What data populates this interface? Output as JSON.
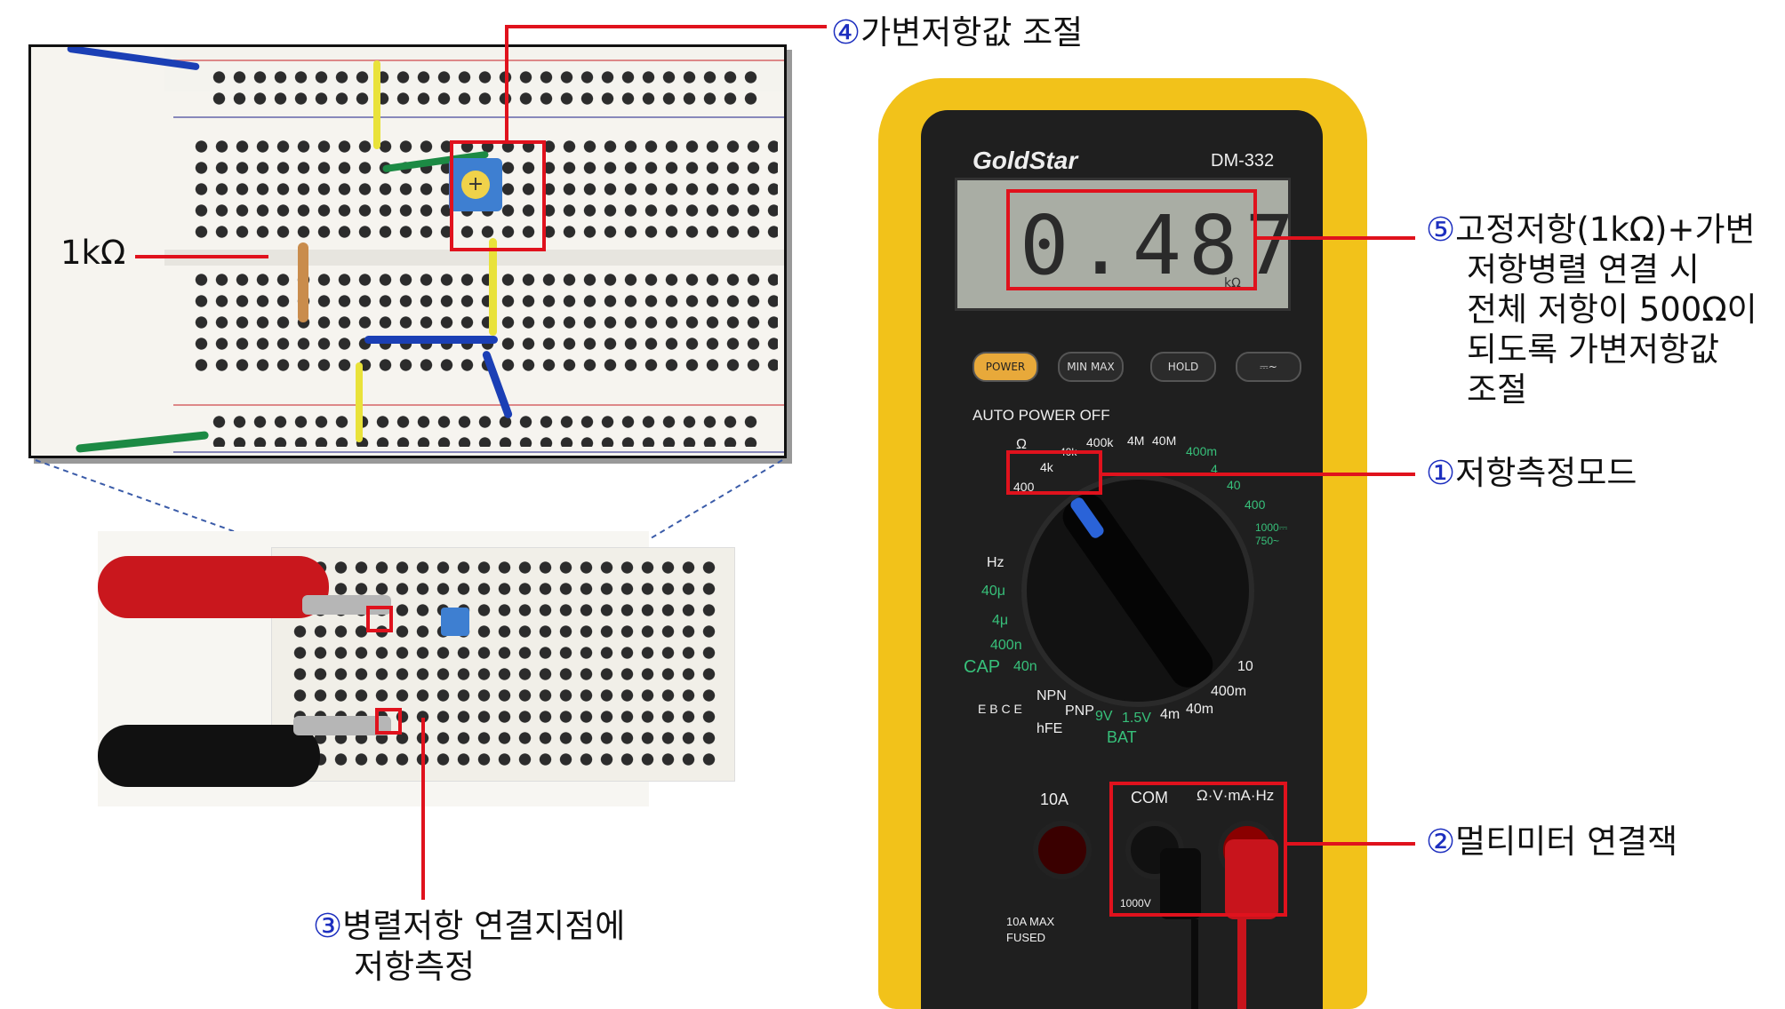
{
  "colors": {
    "callout_red": "#e0121d",
    "number_blue": "#1d2fbf",
    "meter_yellow": "#f2c21a",
    "meter_face": "#1f1f1f",
    "lcd": "#a9ada4"
  },
  "callouts": {
    "c1": {
      "num": "①",
      "text": "저항측정모드"
    },
    "c2": {
      "num": "②",
      "text": "멀티미터 연결잭"
    },
    "c3": {
      "num": "③",
      "line1": "병렬저항 연결지점에",
      "line2": "저항측정"
    },
    "c4": {
      "num": "④",
      "text": "가변저항값 조절"
    },
    "c5": {
      "num": "⑤",
      "line1": "고정저항(1kΩ)+가변",
      "line2": "저항병렬 연결 시",
      "line3": "전체 저항이 500Ω이",
      "line4": "되도록 가변저항값",
      "line5": "조절"
    }
  },
  "zoom": {
    "resistor_label": "1kΩ"
  },
  "meter": {
    "brand": "GoldStar",
    "model": "DM-332",
    "reading": "0.487",
    "unit": "kΩ",
    "buttons": [
      "POWER",
      "MIN MAX",
      "HOLD",
      "⎓~"
    ],
    "auto_power": "AUTO POWER OFF",
    "dial_labels": {
      "ohm": "Ω",
      "r400": "400",
      "r4k": "4k",
      "r40k": "40k",
      "r400k": "400k",
      "r4M": "4M",
      "r40M": "40M",
      "hz": "Hz",
      "c40u": "40μ",
      "c4u": "4μ",
      "c400n": "400n",
      "c40n": "40n",
      "cap": "CAP",
      "npn": "NPN",
      "pnp": "PNP",
      "ebce": "E B C E",
      "hfe": "hFE",
      "bat9": "9V",
      "bat15": "1.5V",
      "bat": "BAT",
      "a4m": "4m",
      "a40m": "40m",
      "a400m": "400m",
      "a10": "10",
      "v400m": "400m",
      "v4": "4",
      "v40": "40",
      "v400": "400",
      "v1000": "1000⎓",
      "v750": "750~"
    },
    "jacks": {
      "a10": "10A",
      "com": "COM",
      "v": "Ω·V·mA·Hz",
      "max": "10A MAX",
      "fused": "FUSED",
      "v1000": "1000V"
    }
  }
}
